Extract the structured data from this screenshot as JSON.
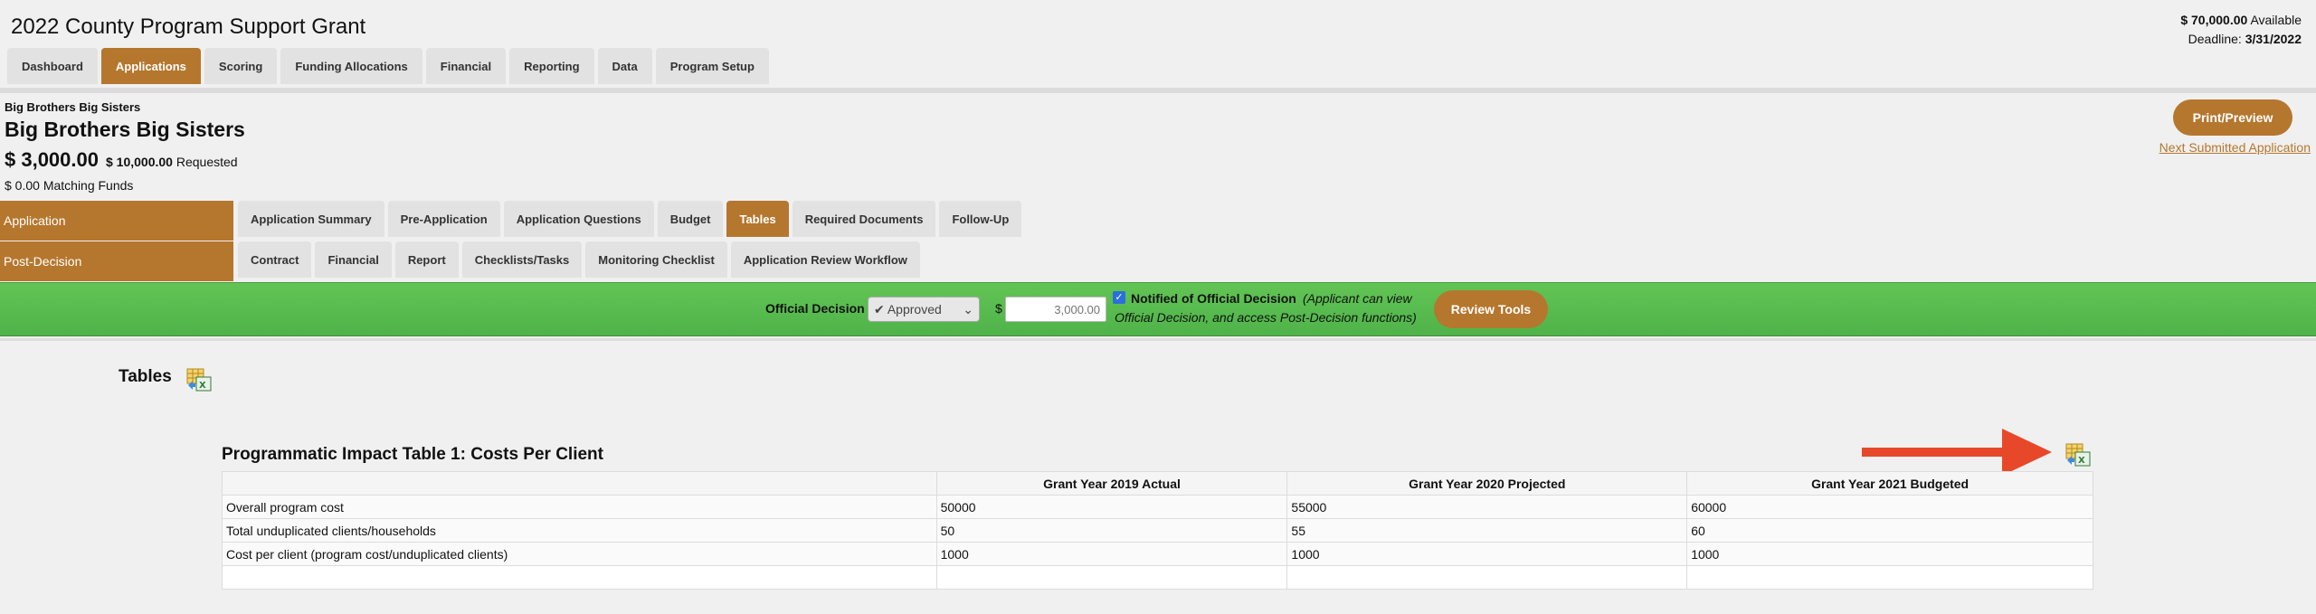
{
  "header": {
    "title": "2022 County Program Support Grant",
    "available_amount": "$ 70,000.00",
    "available_label": "Available",
    "deadline_label": "Deadline:",
    "deadline_value": "3/31/2022"
  },
  "main_tabs": [
    {
      "label": "Dashboard",
      "active": false
    },
    {
      "label": "Applications",
      "active": true
    },
    {
      "label": "Scoring",
      "active": false
    },
    {
      "label": "Funding Allocations",
      "active": false
    },
    {
      "label": "Financial",
      "active": false
    },
    {
      "label": "Reporting",
      "active": false
    },
    {
      "label": "Data",
      "active": false
    },
    {
      "label": "Program Setup",
      "active": false
    }
  ],
  "applicant": {
    "org_small": "Big Brothers Big Sisters",
    "org_name": "Big Brothers Big Sisters",
    "award_amount": "$ 3,000.00",
    "requested_amount": "$ 10,000.00",
    "requested_label": "Requested",
    "matching_funds": "$ 0.00 Matching Funds"
  },
  "actions": {
    "print_preview": "Print/Preview",
    "next_submitted": "Next Submitted Application"
  },
  "sections": {
    "application": {
      "label": "Application",
      "tabs": [
        {
          "label": "Application Summary",
          "active": false
        },
        {
          "label": "Pre-Application",
          "active": false
        },
        {
          "label": "Application Questions",
          "active": false
        },
        {
          "label": "Budget",
          "active": false
        },
        {
          "label": "Tables",
          "active": true
        },
        {
          "label": "Required Documents",
          "active": false
        },
        {
          "label": "Follow-Up",
          "active": false
        }
      ]
    },
    "post_decision": {
      "label": "Post-Decision",
      "tabs": [
        {
          "label": "Contract",
          "active": false
        },
        {
          "label": "Financial",
          "active": false
        },
        {
          "label": "Report",
          "active": false
        },
        {
          "label": "Checklists/Tasks",
          "active": false
        },
        {
          "label": "Monitoring Checklist",
          "active": false
        },
        {
          "label": "Application Review Workflow",
          "active": false
        }
      ]
    }
  },
  "decision": {
    "label": "Official Decision",
    "selected": "✔ Approved",
    "dollar_sign": "$",
    "amount_placeholder": "3,000.00",
    "notified_checked": true,
    "notified_label": "Notified of Official Decision",
    "note_line1": "(Applicant can view",
    "note_line2": "Official Decision, and access Post-Decision functions)",
    "review_tools": "Review Tools"
  },
  "tables_section": {
    "heading": "Tables",
    "table_title": "Programmatic Impact Table 1: Costs Per Client",
    "columns": [
      "",
      "Grant Year 2019 Actual",
      "Grant Year 2020 Projected",
      "Grant Year 2021 Budgeted"
    ],
    "rows": [
      [
        "Overall program cost",
        "50000",
        "55000",
        "60000"
      ],
      [
        "Total unduplicated clients/households",
        "50",
        "55",
        "60"
      ],
      [
        "Cost per client (program cost/unduplicated clients)",
        "1000",
        "1000",
        "1000"
      ],
      [
        "",
        "",
        "",
        ""
      ]
    ]
  },
  "colors": {
    "accent": "#b5772e",
    "decision_bar": "#5bbd4f",
    "arrow": "#e8482a"
  }
}
